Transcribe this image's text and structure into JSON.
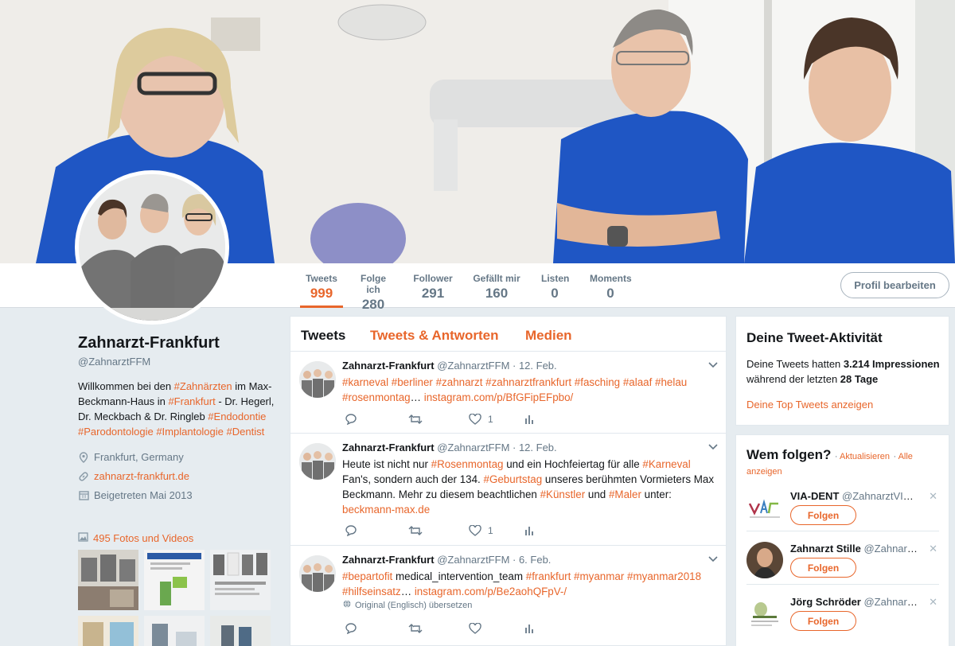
{
  "profile": {
    "name": "Zahnarzt-Frankfurt",
    "handle": "@ZahnarztFFM",
    "bio": {
      "t1": "Willkommen bei den ",
      "h1": "#Zahnärzten",
      "t2": " im Max-Beckmann-Haus in ",
      "h2": "#Frankfurt",
      "t3": " - Dr. Hegerl, Dr. Meckbach & Dr. Ringleb ",
      "h3": "#Endodontie",
      "h4": "#Parodontologie",
      "h5": "#Implantologie",
      "h6": "#Dentist"
    },
    "location": "Frankfurt, Germany",
    "website": "zahnarzt-frankfurt.de",
    "joined": "Beigetreten Mai 2013",
    "photos_link": "495 Fotos und Videos",
    "edit_button": "Profil bearbeiten"
  },
  "stats": [
    {
      "label": "Tweets",
      "value": "999"
    },
    {
      "label": "Folge ich",
      "value": "280"
    },
    {
      "label": "Follower",
      "value": "291"
    },
    {
      "label": "Gefällt mir",
      "value": "160"
    },
    {
      "label": "Listen",
      "value": "0"
    },
    {
      "label": "Moments",
      "value": "0"
    }
  ],
  "timeline": {
    "tabs": [
      "Tweets",
      "Tweets & Antworten",
      "Medien"
    ],
    "tweets": [
      {
        "name": "Zahnarzt-Frankfurt",
        "handle": "@ZahnarztFFM · 12. Feb.",
        "line1": "#karneval #berliner #zahnarzt #zahnarztfrankfurt #fasching #alaaf #helau",
        "line2a": "#rosenmontag",
        "line2b": "… ",
        "line2c": "instagram.com/p/BfGFipEFpbo/",
        "likes": "1"
      },
      {
        "name": "Zahnarzt-Frankfurt",
        "handle": "@ZahnarztFFM · 12. Feb.",
        "p1": "Heute ist nicht nur ",
        "h1": "#Rosenmontag",
        "p2": " und ein Hochfeiertag für alle ",
        "h2": "#Karneval",
        "p3": " Fan's, sondern auch der 134. ",
        "h3": "#Geburtstag",
        "p4": " unseres berühmten Vormieters Max Beckmann. Mehr zu diesem beachtlichen ",
        "h4": "#Künstler",
        "p5": " und ",
        "h5": "#Maler",
        "p6": " unter: ",
        "link": "beckmann-max.de",
        "likes": "1"
      },
      {
        "name": "Zahnarzt-Frankfurt",
        "handle": "@ZahnarztFFM · 6. Feb.",
        "h1": "#bepartofit",
        "p1": " medical_intervention_team ",
        "h2": "#frankfurt #myanmar #myanmar2018",
        "h3": "#hilfseinsatz",
        "p2": "… ",
        "link": "instagram.com/p/Be2aohQFpV-/",
        "translate": "Original (Englisch) übersetzen"
      }
    ]
  },
  "activity": {
    "title": "Deine Tweet-Aktivität",
    "t1": "Deine Tweets hatten ",
    "impressions": "3.214 Impressionen",
    "t2": "während der letzten ",
    "days": "28 Tage",
    "link": "Deine Top Tweets anzeigen"
  },
  "who_to_follow": {
    "title": "Wem folgen?",
    "refresh": "Aktualisieren",
    "all": "Alle anzeigen",
    "follow_label": "Folgen",
    "items": [
      {
        "name": "VIA-DENT",
        "handle": "@ZahnarztVIAD…"
      },
      {
        "name": "Zahnarzt Stille",
        "handle": "@Zahnarzt…"
      },
      {
        "name": "Jörg Schröder",
        "handle": "@Zahnarztn…"
      }
    ]
  },
  "colors": {
    "accent": "#e8662b",
    "text": "#14171a",
    "muted": "#657786",
    "background": "#e6ecf0"
  },
  "icons": [
    "location-icon",
    "link-icon",
    "calendar-icon",
    "photo-icon",
    "reply-icon",
    "retweet-icon",
    "like-icon",
    "analytics-icon",
    "globe-icon",
    "close-icon",
    "chevron-down-icon"
  ]
}
